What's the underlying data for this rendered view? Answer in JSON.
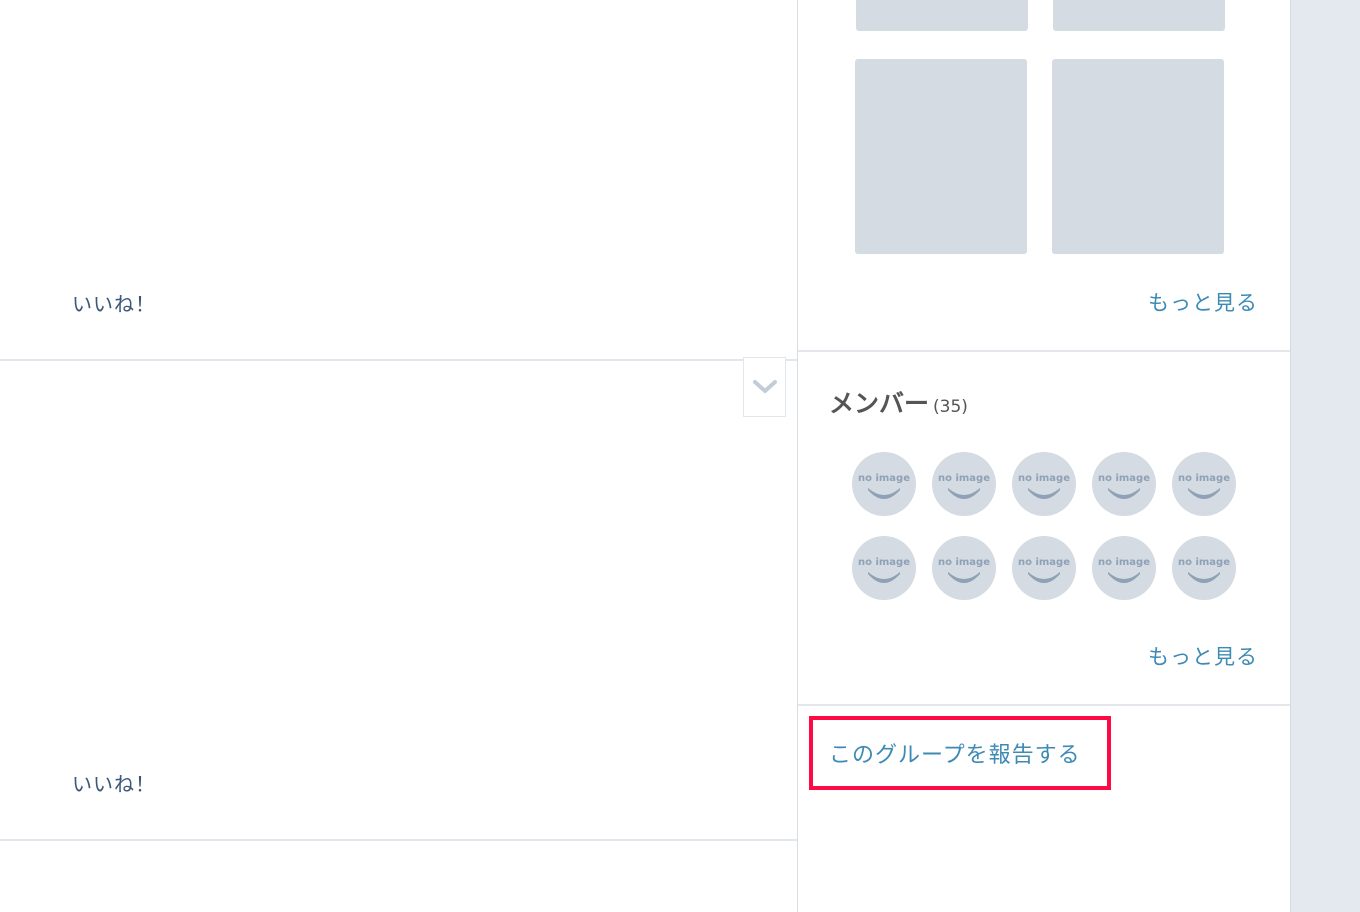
{
  "feed": {
    "posts": [
      {
        "like_label": "いいね！"
      },
      {
        "like_label": "いいね！"
      }
    ]
  },
  "photos": {
    "more_label": "もっと見る"
  },
  "members": {
    "title": "メンバー",
    "count": "(35)",
    "avatar_label": "no image",
    "more_label": "もっと見る"
  },
  "report": {
    "label": "このグループを報告する",
    "highlight_color": "#ff0a45"
  },
  "icons": {
    "expand": "chevron-down-icon",
    "avatar": "no-image-avatar-icon"
  },
  "colors": {
    "link": "#3d8ab5",
    "like_text": "#3d5779",
    "placeholder": "#d4dbe2",
    "gutter": "#e4e8ef"
  }
}
